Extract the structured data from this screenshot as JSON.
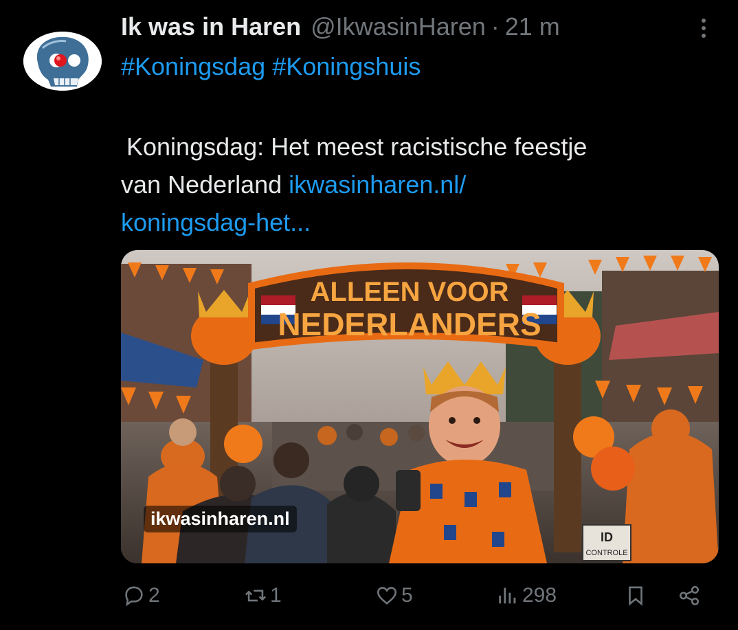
{
  "tweet": {
    "author_name": "Ik was in Haren",
    "handle": "@IkwasinHaren",
    "separator": "·",
    "time": "21 m",
    "hashtags": [
      "#Koningsdag",
      "#Koningshuis"
    ],
    "text_line1": "Koningsdag: Het meest racistische feestje",
    "text_line2": "van Nederland ",
    "link_part1": "ikwasinharen.nl/",
    "link_part2": "koningsdag-het..."
  },
  "media": {
    "banner_line1": "ALLEEN VOOR",
    "banner_line2": "NEDERLANDERS",
    "sign_line1": "ID",
    "sign_line2": "CONTROLE",
    "source_label": "ikwasinharen.nl"
  },
  "actions": {
    "replies": "2",
    "reposts": "1",
    "likes": "5",
    "views": "298"
  },
  "colors": {
    "background": "#000000",
    "text": "#e7e9ea",
    "muted": "#71767b",
    "link": "#1d9bf0",
    "orange": "#f07a1a"
  },
  "icons": [
    "skull-avatar-icon",
    "more-icon",
    "reply-icon",
    "repost-icon",
    "like-icon",
    "views-icon",
    "bookmark-icon",
    "share-icon"
  ]
}
